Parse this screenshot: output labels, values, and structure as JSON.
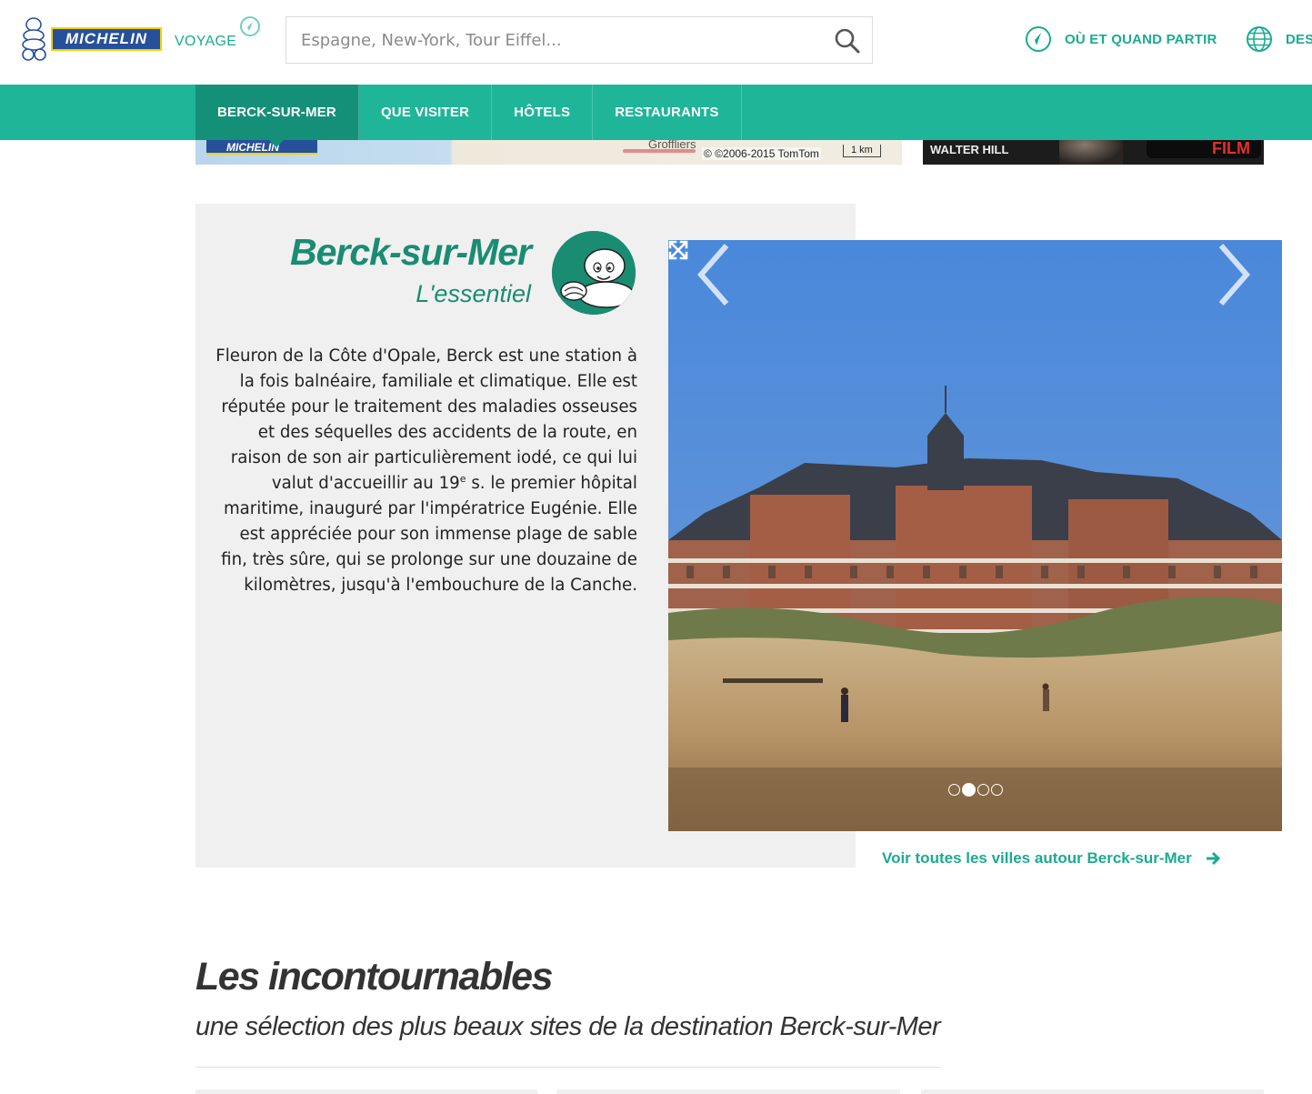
{
  "brand": {
    "logo_text": "MICHELIN",
    "section": "VOYAGE"
  },
  "search": {
    "placeholder": "Espagne, New-York, Tour Eiffel..."
  },
  "top_links": {
    "when": "OÙ ET QUAND PARTIR",
    "dest": "DES"
  },
  "nav": {
    "items": [
      "BERCK-SUR-MER",
      "QUE VISITER",
      "HÔTELS",
      "RESTAURANTS"
    ],
    "active_index": 0
  },
  "map": {
    "logo_text": "MICHELIN",
    "place": "Groffliers",
    "copyright": "© ©2006-2015 TomTom",
    "scale": "1 km"
  },
  "ad": {
    "text": "WALTER HILL",
    "button": "FILM"
  },
  "essentials": {
    "title": "Berck-sur-Mer",
    "subtitle": "L'essentiel",
    "text_before_sup": "Fleuron de la Côte d'Opale, Berck est une station à la fois balnéaire, familiale et climatique. Elle est réputée pour le traitement des maladies osseuses et des séquelles des accidents de la route, en raison de son air particulièrement iodé, ce qui lui valut d'accueillir au 19",
    "sup": "e",
    "text_after_sup": " s. le premier hôpital maritime, inauguré par l'impératrice Eugénie. Elle est appréciée pour son immense plage de sable fin, très sûre, qui se prolonge sur une douzaine de kilomètres, jusqu'à l'embouchure de la Canche."
  },
  "gallery": {
    "slide_count": 4,
    "active_slide": 1
  },
  "see_all": {
    "label": "Voir toutes les villes autour Berck-sur-Mer"
  },
  "must_see": {
    "title": "Les incontournables",
    "subtitle": "une sélection des plus beaux sites de la destination Berck-sur-Mer"
  },
  "colors": {
    "brand_green": "#1fb598",
    "dark_green": "#1a8c72",
    "michelin_blue": "#27509b"
  }
}
